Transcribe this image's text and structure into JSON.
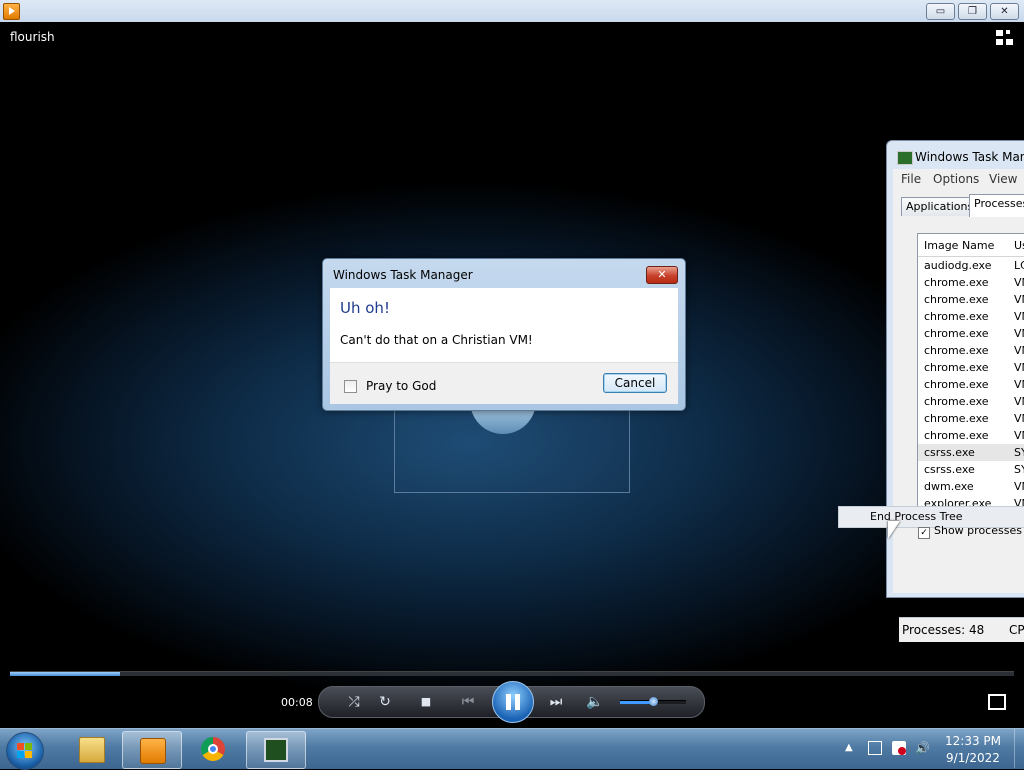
{
  "window": {
    "minimize_label": "▭",
    "restore_label": "❐",
    "close_label": "✕"
  },
  "video": {
    "title": "flourish"
  },
  "player": {
    "time": "00:08",
    "progress_fraction": 0.11,
    "volume_fraction": 0.5,
    "stop_glyph": "■",
    "prev_glyph": "⏮",
    "next_glyph": "⏭",
    "volume_glyph": "🔈",
    "repeat_glyph": "↻",
    "shuffle_glyph": "⤮"
  },
  "task_manager": {
    "title": "Windows Task Mana",
    "menu": [
      "File",
      "Options",
      "View"
    ],
    "tabs": [
      "Applications",
      "Processes"
    ],
    "columns": [
      "Image Name",
      "Us"
    ],
    "rows": [
      {
        "name": "audiodg.exe",
        "user": "LC"
      },
      {
        "name": "chrome.exe",
        "user": "VM"
      },
      {
        "name": "chrome.exe",
        "user": "VM"
      },
      {
        "name": "chrome.exe",
        "user": "VM"
      },
      {
        "name": "chrome.exe",
        "user": "VM"
      },
      {
        "name": "chrome.exe",
        "user": "VM"
      },
      {
        "name": "chrome.exe",
        "user": "VM"
      },
      {
        "name": "chrome.exe",
        "user": "VM"
      },
      {
        "name": "chrome.exe",
        "user": "VM"
      },
      {
        "name": "chrome.exe",
        "user": "VM"
      },
      {
        "name": "chrome.exe",
        "user": "VM"
      },
      {
        "name": "csrss.exe",
        "user": "SY"
      },
      {
        "name": "csrss.exe",
        "user": "SY"
      },
      {
        "name": "dwm.exe",
        "user": "VM"
      },
      {
        "name": "explorer.exe",
        "user": "VM"
      }
    ],
    "selected_row_index": 11,
    "context_menu_item": "End Process Tree",
    "show_all_label": "Show processes fro",
    "show_all_checked": "✓",
    "status_processes": "Processes: 48",
    "status_cpu": "CPU"
  },
  "dialog": {
    "title": "Windows Task Manager",
    "close_label": "✕",
    "heading": "Uh oh!",
    "message": "Can't do that on a Christian VM!",
    "checkbox_label": "Pray to God",
    "cancel_label": "Cancel"
  },
  "taskbar": {
    "clock_time": "12:33 PM",
    "clock_date": "9/1/2022",
    "tray_arrow": "▲",
    "items": [
      "start-button",
      "explorer",
      "media-player",
      "chrome",
      "task-manager"
    ]
  },
  "colors": {
    "dialog_heading": "#1e3b8f",
    "accent_blue": "#3f9aff"
  }
}
